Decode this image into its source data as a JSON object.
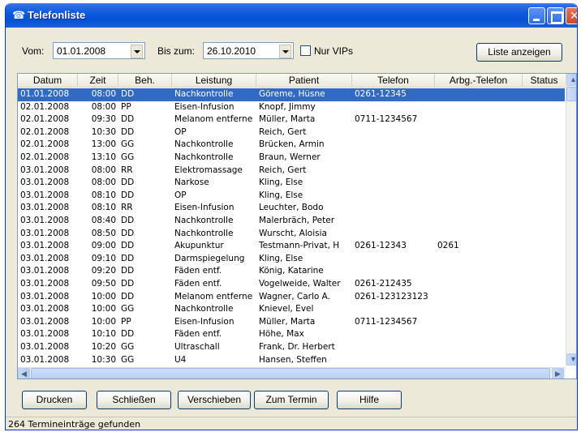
{
  "window": {
    "title": "Telefonliste",
    "icon": "phone-icon"
  },
  "filter": {
    "von_label": "Vom:",
    "von_value": "01.01.2008",
    "bis_label": "Bis zum:",
    "bis_value": "26.10.2010",
    "vip_label": "Nur VIPs",
    "show_button": "Liste anzeigen"
  },
  "table": {
    "columns": [
      "Datum",
      "Zeit",
      "Beh.",
      "Leistung",
      "Patient",
      "Telefon",
      "Arbg.-Telefon",
      "Status"
    ],
    "rows": [
      [
        "01.01.2008",
        "08:00",
        "DD",
        "Nachkontrolle",
        "Göreme, Hüsne",
        "0261-12345",
        "",
        ""
      ],
      [
        "02.01.2008",
        "08:00",
        "PP",
        "Eisen-Infusion",
        "Knopf, Jimmy",
        "",
        "",
        ""
      ],
      [
        "02.01.2008",
        "09:30",
        "DD",
        "Melanom entferne",
        "Müller, Marta",
        "0711-1234567",
        "",
        ""
      ],
      [
        "02.01.2008",
        "10:30",
        "DD",
        "OP",
        "Reich, Gert",
        "",
        "",
        ""
      ],
      [
        "02.01.2008",
        "13:00",
        "GG",
        "Nachkontrolle",
        "Brücken, Armin",
        "",
        "",
        ""
      ],
      [
        "02.01.2008",
        "13:10",
        "GG",
        "Nachkontrolle",
        "Braun, Werner",
        "",
        "",
        ""
      ],
      [
        "03.01.2008",
        "08:00",
        "RR",
        "Elektromassage",
        "Reich, Gert",
        "",
        "",
        ""
      ],
      [
        "03.01.2008",
        "08:00",
        "DD",
        "Narkose",
        "Kling, Else",
        "",
        "",
        ""
      ],
      [
        "03.01.2008",
        "08:10",
        "DD",
        "OP",
        "Kling, Else",
        "",
        "",
        ""
      ],
      [
        "03.01.2008",
        "08:10",
        "RR",
        "Eisen-Infusion",
        "Leuchter, Bodo",
        "",
        "",
        ""
      ],
      [
        "03.01.2008",
        "08:40",
        "DD",
        "Nachkontrolle",
        "Malerbräch, Peter",
        "",
        "",
        ""
      ],
      [
        "03.01.2008",
        "08:50",
        "DD",
        "Nachkontrolle",
        "Wurscht, Aloisia",
        "",
        "",
        ""
      ],
      [
        "03.01.2008",
        "09:00",
        "DD",
        "Akupunktur",
        "Testmann-Privat, H",
        "0261-12343",
        "0261",
        ""
      ],
      [
        "03.01.2008",
        "09:10",
        "DD",
        "Darmspiegelung",
        "Kling, Else",
        "",
        "",
        ""
      ],
      [
        "03.01.2008",
        "09:20",
        "DD",
        "Fäden entf.",
        "König, Katarine",
        "",
        "",
        ""
      ],
      [
        "03.01.2008",
        "09:50",
        "DD",
        "Fäden entf.",
        "Vogelweide, Walter",
        "0261-212435",
        "",
        ""
      ],
      [
        "03.01.2008",
        "10:00",
        "DD",
        "Melanom entferne",
        "Wagner, Carlo A.",
        "0261-123123123",
        "",
        ""
      ],
      [
        "03.01.2008",
        "10:00",
        "GG",
        "Nachkontrolle",
        "Knievel, Evel",
        "",
        "",
        ""
      ],
      [
        "03.01.2008",
        "10:00",
        "PP",
        "Eisen-Infusion",
        "Müller, Marta",
        "0711-1234567",
        "",
        ""
      ],
      [
        "03.01.2008",
        "10:10",
        "DD",
        "Fäden entf.",
        "Höhe, Max",
        "",
        "",
        ""
      ],
      [
        "03.01.2008",
        "10:20",
        "GG",
        "Ultraschall",
        "Frank, Dr. Herbert",
        "",
        "",
        ""
      ],
      [
        "03.01.2008",
        "10:30",
        "GG",
        "U4",
        "Hansen, Steffen",
        "",
        "",
        ""
      ]
    ]
  },
  "buttons": {
    "print": "Drucken",
    "close": "Schließen",
    "move": "Verschieben",
    "to_appointment": "Zum Termin",
    "help": "Hilfe"
  },
  "status": {
    "text": "264 Termineinträge gefunden"
  }
}
